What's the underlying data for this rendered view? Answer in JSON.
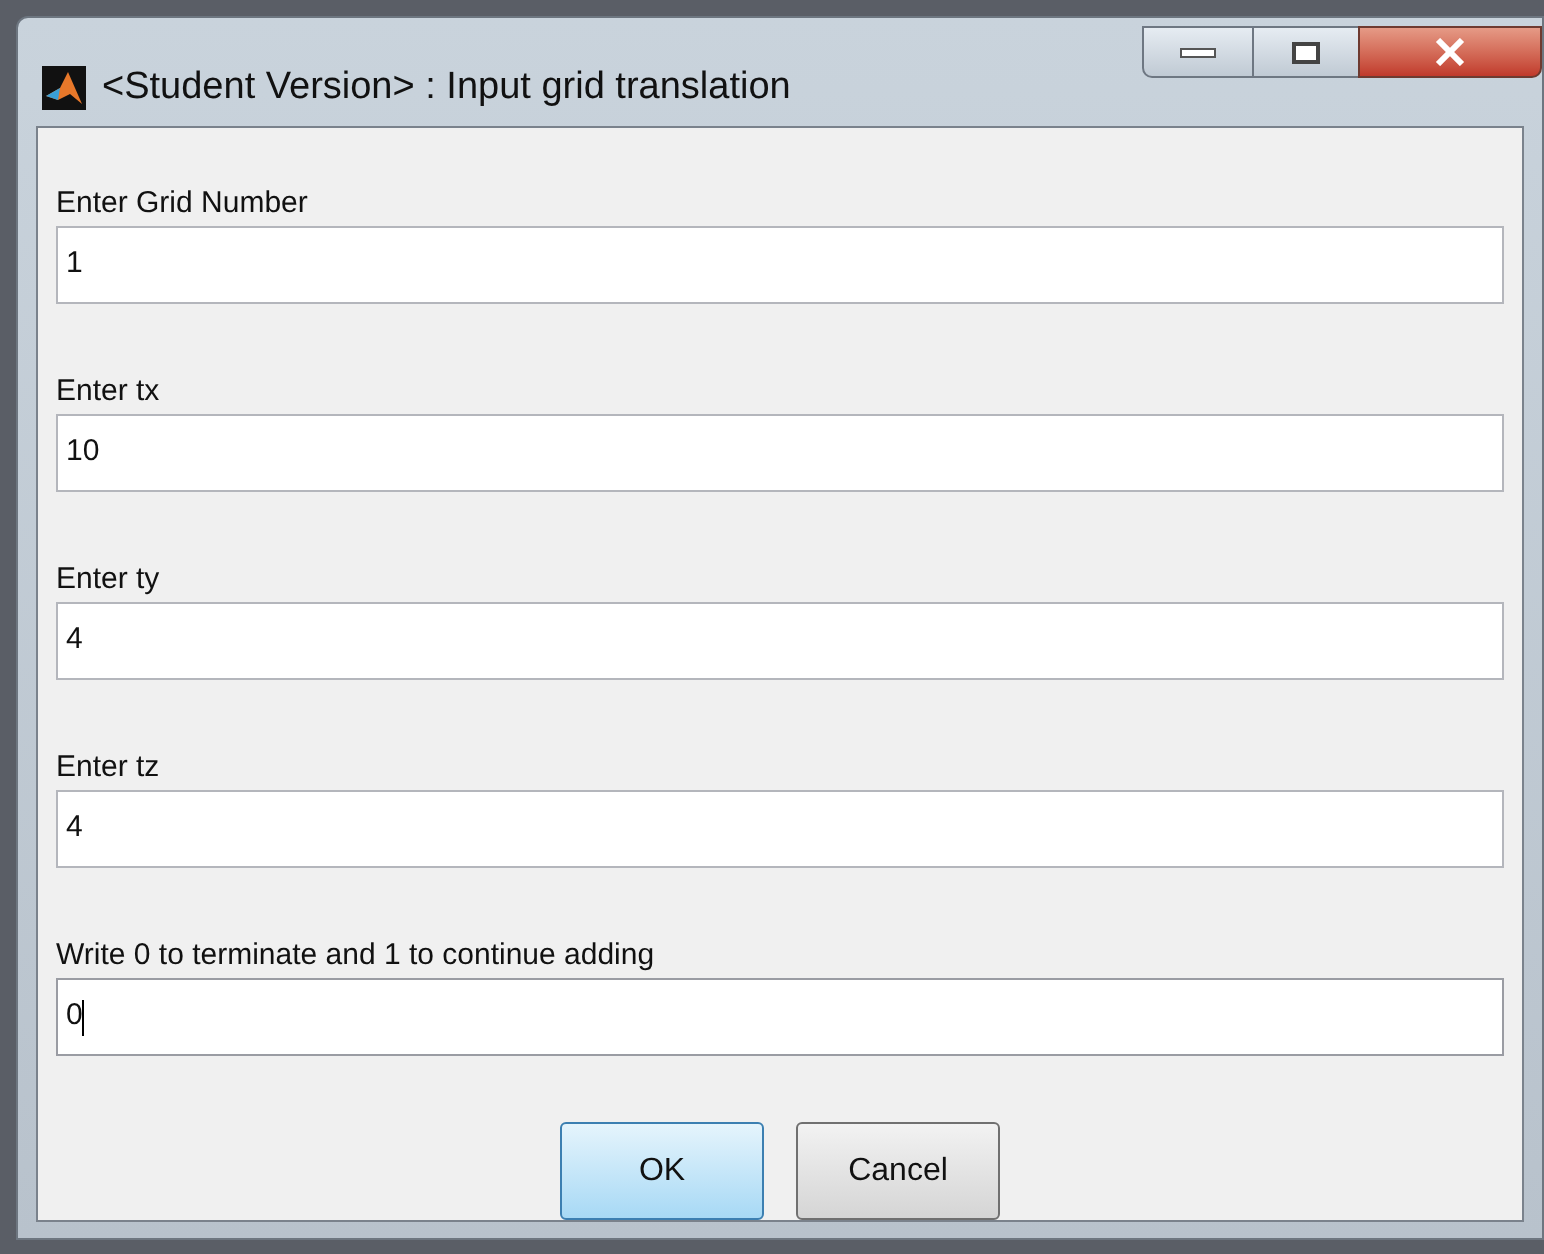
{
  "window": {
    "title": "<Student Version> : Input grid translation"
  },
  "fields": [
    {
      "label": "Enter Grid Number",
      "value": "1",
      "focused": false
    },
    {
      "label": "Enter tx",
      "value": "10",
      "focused": false
    },
    {
      "label": "Enter ty",
      "value": "4",
      "focused": false
    },
    {
      "label": "Enter tz",
      "value": "4",
      "focused": false
    },
    {
      "label": "Write 0 to terminate and 1 to continue adding",
      "value": "0",
      "focused": true
    }
  ],
  "buttons": [
    {
      "label": "OK",
      "default": true
    },
    {
      "label": "Cancel",
      "default": false
    }
  ]
}
